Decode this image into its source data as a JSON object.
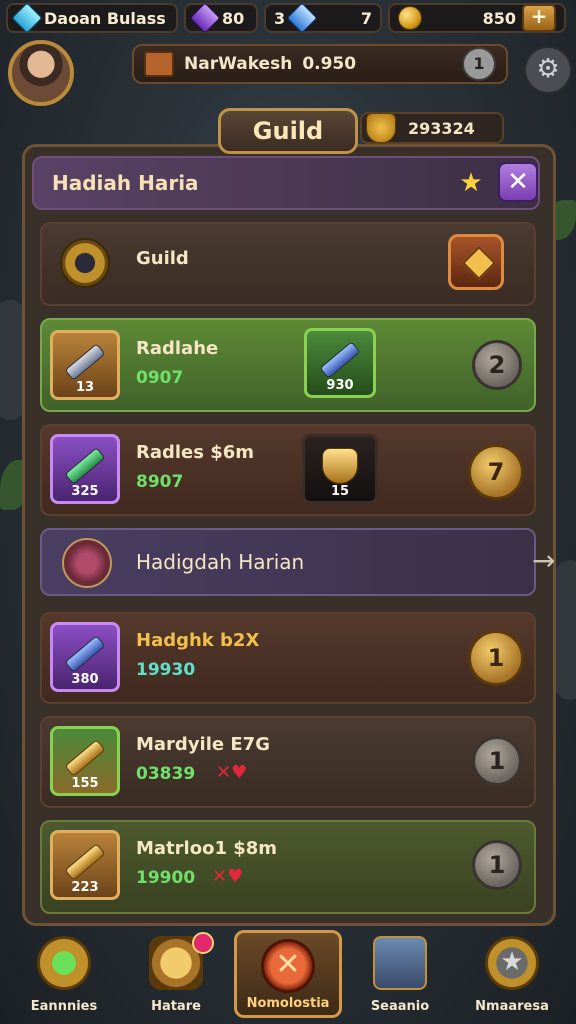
{
  "topbar": {
    "gem_label": "Daoan Bulass",
    "purple_value": "80",
    "blue_value": "3",
    "blue_value2": "7",
    "gold_value": "850",
    "plus": "+"
  },
  "player": {
    "name": "NarWakesh",
    "amount": "0.950",
    "level": "1",
    "settings_icon": "⚙"
  },
  "guild": {
    "title": "Guild",
    "score": "293324"
  },
  "panel": {
    "header": "Hadiah Haria",
    "star": "★",
    "close": "✕",
    "guild_row_label": "Guild",
    "rows": [
      {
        "name": "Radlahe",
        "value": "0907",
        "item_num": "13",
        "item2_num": "930",
        "count": "2"
      },
      {
        "name": "Radles $6m",
        "value": "8907",
        "item_num": "325",
        "item2_num": "15",
        "count": "7"
      },
      {
        "name": "Hadigdah Harian",
        "arrow": "→"
      },
      {
        "name": "Hadghk b2X",
        "value": "19930",
        "item_num": "380",
        "count": "1"
      },
      {
        "name": "Mardyile E7G",
        "value": "03839",
        "item_num": "155",
        "count": "1"
      },
      {
        "name": "Matrloo1 $8m",
        "value": "19900",
        "item_num": "223",
        "count": "1"
      }
    ]
  },
  "nav": [
    {
      "label": "Eannnies"
    },
    {
      "label": "Hatare"
    },
    {
      "label": "Nomolostia"
    },
    {
      "label": "Seaanio"
    },
    {
      "label": "Nmaaresa"
    }
  ]
}
